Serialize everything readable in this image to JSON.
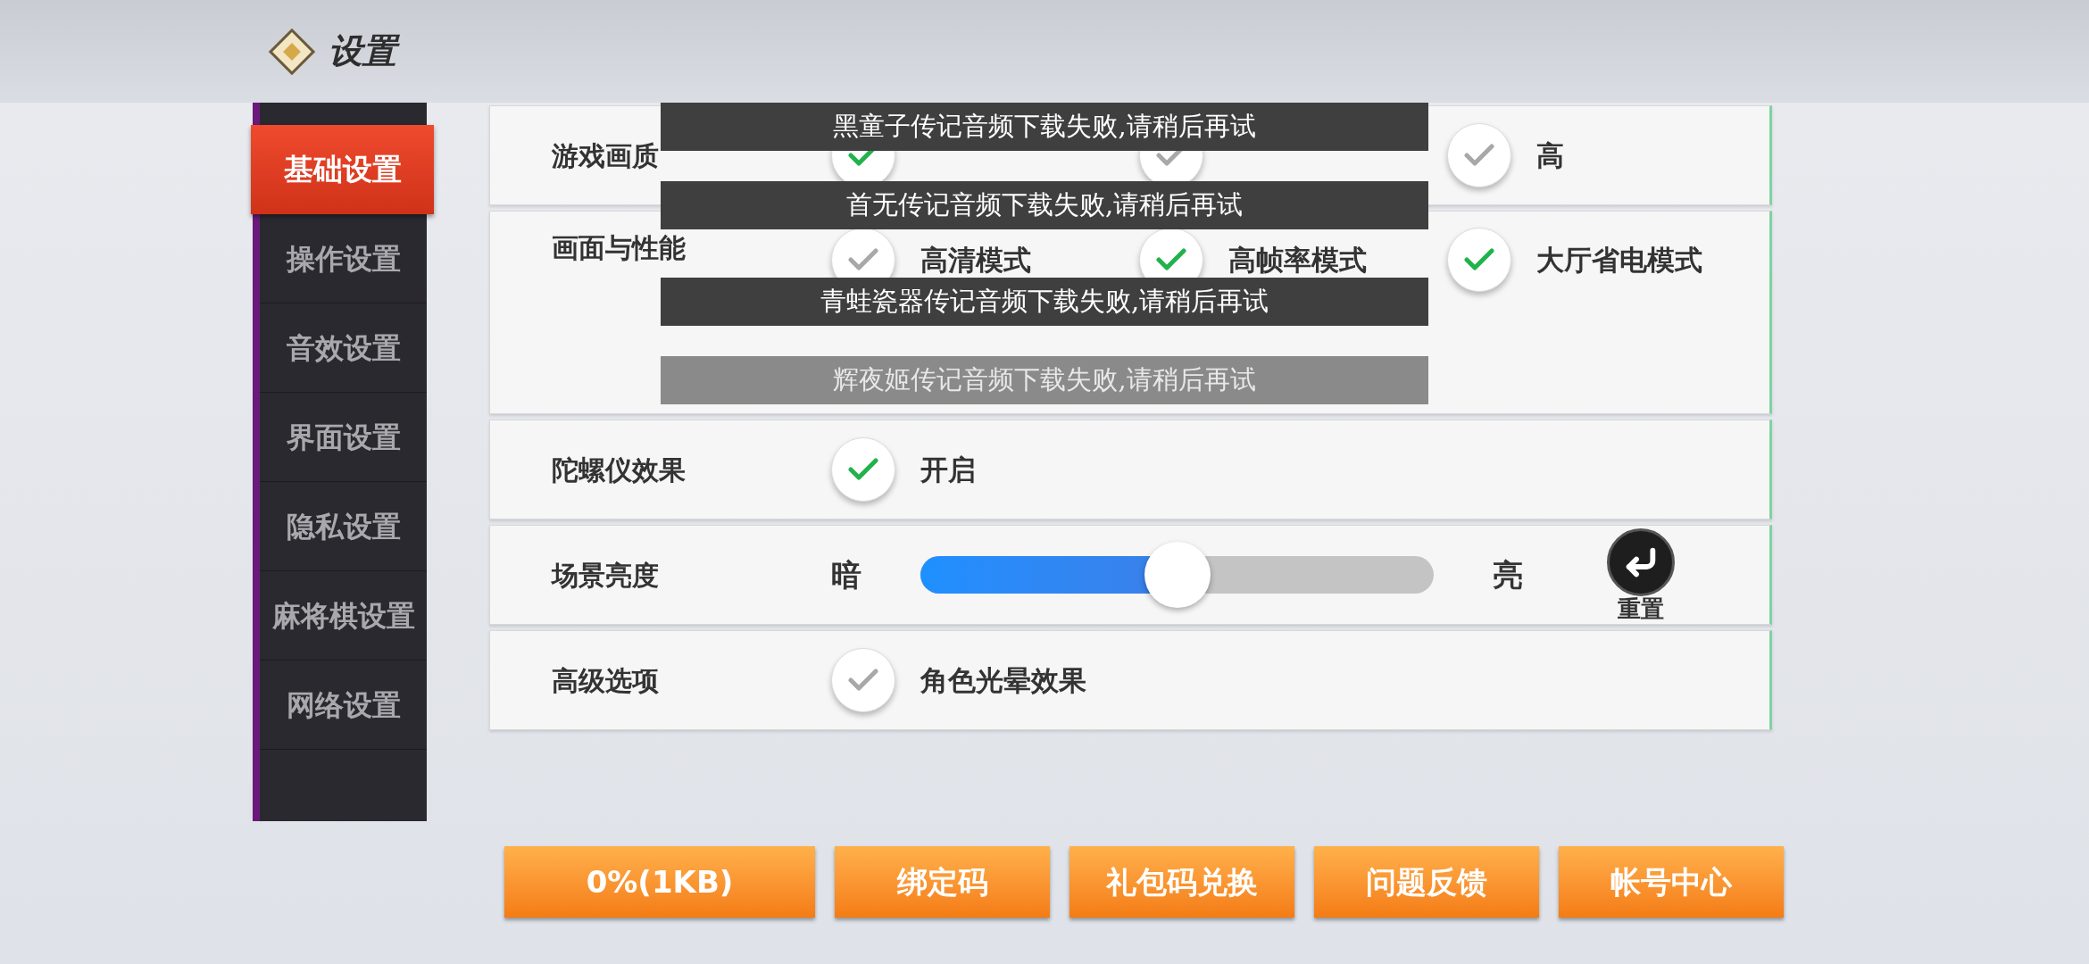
{
  "header": {
    "title": "设置"
  },
  "sidebar": {
    "items": [
      {
        "label": "基础设置",
        "selected": true
      },
      {
        "label": "操作设置",
        "selected": false
      },
      {
        "label": "音效设置",
        "selected": false
      },
      {
        "label": "界面设置",
        "selected": false
      },
      {
        "label": "隐私设置",
        "selected": false
      },
      {
        "label": "麻将棋设置",
        "selected": false
      },
      {
        "label": "网络设置",
        "selected": false
      }
    ]
  },
  "settings": [
    {
      "kind": "options",
      "label": "游戏画质",
      "options": [
        {
          "checked": true
        },
        {
          "checked": false
        },
        {
          "label": "高",
          "checked": false
        }
      ]
    },
    {
      "kind": "options",
      "label": "画面与性能",
      "tall": true,
      "options": [
        {
          "label": "高清模式",
          "checked": false
        },
        {
          "label": "高帧率模式",
          "checked": true
        },
        {
          "label": "大厅省电模式",
          "checked": true
        }
      ]
    },
    {
      "kind": "options",
      "label": "陀螺仪效果",
      "options": [
        {
          "label": "开启",
          "checked": true
        }
      ]
    },
    {
      "kind": "slider",
      "label": "场景亮度",
      "min_label": "暗",
      "max_label": "亮",
      "level": 0.5,
      "reset": "重置"
    },
    {
      "kind": "options",
      "label": "高级选项",
      "options": [
        {
          "label": "角色光晕效果",
          "checked": false
        }
      ]
    }
  ],
  "toasts": [
    {
      "text": "黑童子传记音频下载失败,请稍后再试",
      "faded": false
    },
    {
      "text": "首无传记音频下载失败,请稍后再试",
      "faded": false
    },
    {
      "text": "青蛙瓷器传记音频下载失败,请稍后再试",
      "faded": false
    },
    {
      "text": "辉夜姬传记音频下载失败,请稍后再试",
      "faded": true
    }
  ],
  "buttons": [
    "0%(1KB)",
    "绑定码",
    "礼包码兑换",
    "问题反馈",
    "帐号中心"
  ]
}
